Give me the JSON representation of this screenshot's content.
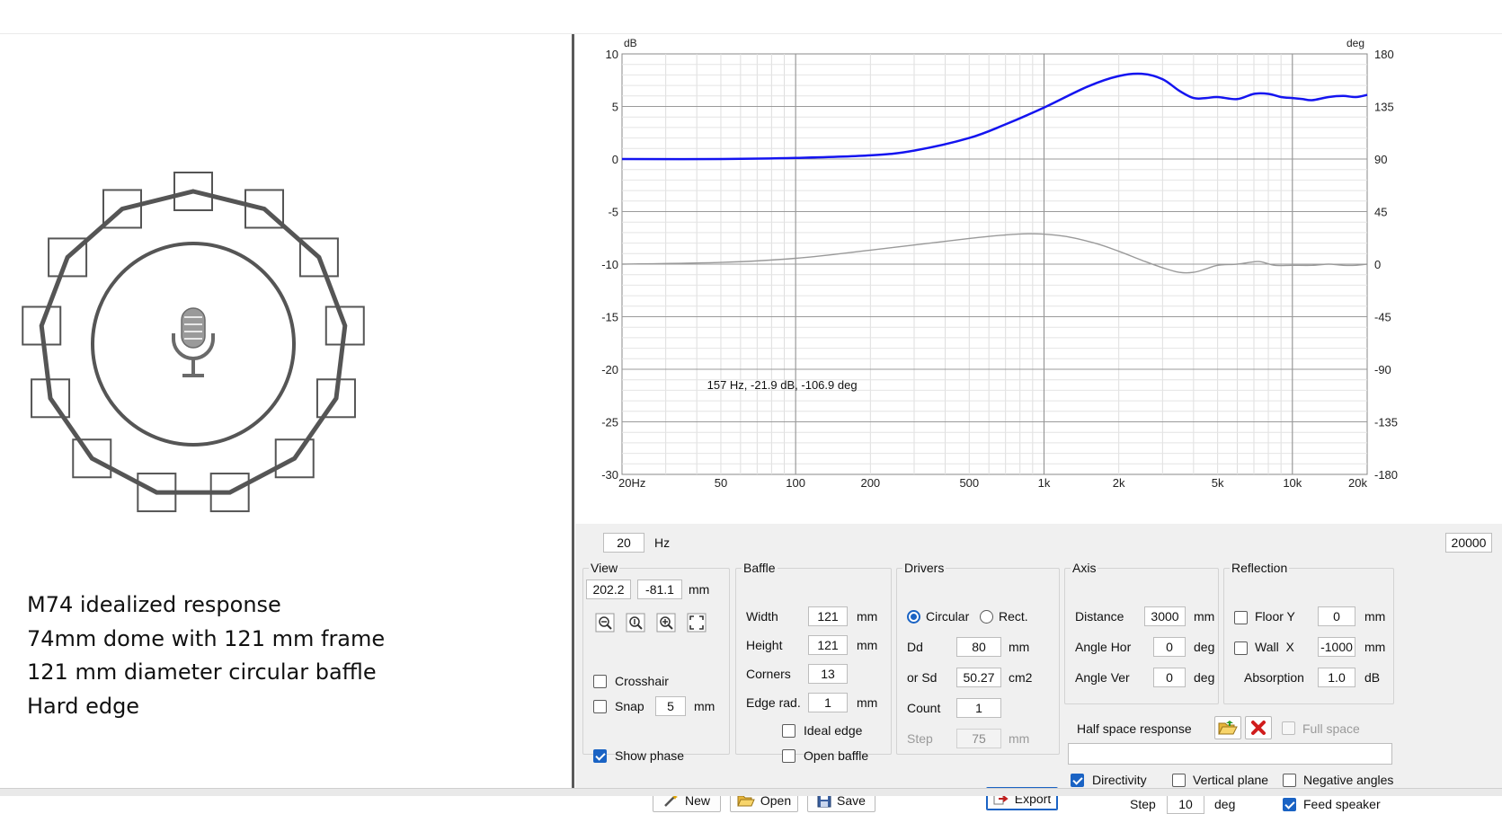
{
  "notes": [
    "M74 idealized response",
    "74mm dome with 121 mm frame",
    "121 mm diameter circular baffle",
    "Hard edge"
  ],
  "chart_data": {
    "type": "line",
    "x_scale": "log",
    "xlim": [
      20,
      20000
    ],
    "ylim": [
      -30,
      10
    ],
    "y2lim": [
      -180,
      180
    ],
    "ylabel": "dB",
    "y2label": "deg",
    "x_ticks": [
      {
        "v": 20,
        "label": "20Hz"
      },
      {
        "v": 50,
        "label": "50"
      },
      {
        "v": 100,
        "label": "100"
      },
      {
        "v": 200,
        "label": "200"
      },
      {
        "v": 500,
        "label": "500"
      },
      {
        "v": 1000,
        "label": "1k"
      },
      {
        "v": 2000,
        "label": "2k"
      },
      {
        "v": 5000,
        "label": "5k"
      },
      {
        "v": 10000,
        "label": "10k"
      },
      {
        "v": 20000,
        "label": "20k"
      }
    ],
    "y_ticks": [
      10,
      5,
      0,
      -5,
      -10,
      -15,
      -20,
      -25,
      -30
    ],
    "y2_ticks": [
      180,
      135,
      90,
      45,
      0,
      -45,
      -90,
      -135,
      -180
    ],
    "grid": true,
    "cursor_readout": "157 Hz, -21.9 dB, -106.9 deg",
    "series": [
      {
        "axis": "left",
        "color": "#1414f0",
        "x": [
          20,
          50,
          100,
          200,
          300,
          500,
          700,
          1000,
          1500,
          2000,
          2500,
          3000,
          3500,
          4000,
          4500,
          5000,
          6000,
          7000,
          8000,
          9000,
          10000,
          11000,
          12000,
          14000,
          16000,
          18000,
          20000
        ],
        "y": [
          0,
          0,
          0.1,
          0.35,
          0.8,
          2.0,
          3.3,
          4.9,
          6.9,
          7.9,
          8.1,
          7.6,
          6.5,
          5.8,
          5.8,
          5.9,
          5.7,
          6.2,
          6.2,
          5.9,
          5.8,
          5.7,
          5.6,
          5.9,
          6.0,
          5.9,
          6.1
        ]
      },
      {
        "axis": "right",
        "color": "#9a9a9a",
        "x": [
          20,
          50,
          100,
          200,
          500,
          700,
          900,
          1200,
          1600,
          2000,
          2500,
          3000,
          3500,
          4000,
          4500,
          5000,
          6000,
          7000,
          7500,
          8500,
          10000,
          12000,
          14000,
          16000,
          18000,
          20000
        ],
        "y": [
          0,
          1.5,
          5,
          12,
          22,
          25,
          26,
          24,
          18,
          11,
          3,
          -3,
          -7,
          -7,
          -4,
          -1,
          0,
          2,
          2,
          -1,
          -1,
          -1,
          0,
          -1,
          -1,
          0
        ]
      }
    ]
  },
  "freq_range": {
    "min": "20",
    "unit": "Hz",
    "max": "20000"
  },
  "view": {
    "title": "View",
    "x": "202.2",
    "y": "-81.1",
    "unit": "mm",
    "crosshair": "Crosshair",
    "snap": "Snap",
    "snap_value": "5",
    "snap_unit": "mm",
    "show_phase": "Show phase"
  },
  "baffle": {
    "title": "Baffle",
    "width_label": "Width",
    "width": "121",
    "width_unit": "mm",
    "height_label": "Height",
    "height": "121",
    "height_unit": "mm",
    "corners_label": "Corners",
    "corners": "13",
    "edge_label": "Edge rad.",
    "edge": "1",
    "edge_unit": "mm",
    "ideal_edge": "Ideal edge",
    "open_baffle": "Open baffle"
  },
  "drivers": {
    "title": "Drivers",
    "circular": "Circular",
    "rect": "Rect.",
    "dd_label": "Dd",
    "dd": "80",
    "dd_unit": "mm",
    "sd_label": "or Sd",
    "sd": "50.27",
    "sd_unit": "cm2",
    "count_label": "Count",
    "count": "1",
    "step_label": "Step",
    "step": "75",
    "step_unit": "mm"
  },
  "axis": {
    "title": "Axis",
    "distance_label": "Distance",
    "distance": "3000",
    "distance_unit": "mm",
    "hor_label": "Angle Hor",
    "hor": "0",
    "hor_unit": "deg",
    "ver_label": "Angle Ver",
    "ver": "0",
    "ver_unit": "deg"
  },
  "reflection": {
    "title": "Reflection",
    "floor_label": "Floor Y",
    "floor": "0",
    "floor_unit": "mm",
    "wall_label": "Wall  X",
    "wall": "-1000",
    "wall_unit": "mm",
    "absorption_label": "Absorption",
    "absorption": "1.0",
    "absorption_unit": "dB"
  },
  "half_space": {
    "label": "Half space response",
    "full_space": "Full space",
    "path": ""
  },
  "directivity": {
    "directivity": "Directivity",
    "vertical_plane": "Vertical plane",
    "negative_angles": "Negative angles",
    "step_label": "Step",
    "step": "10",
    "step_unit": "deg",
    "feed_speaker": "Feed speaker"
  },
  "buttons": {
    "new": "New",
    "open": "Open",
    "save": "Save",
    "export": "Export"
  }
}
